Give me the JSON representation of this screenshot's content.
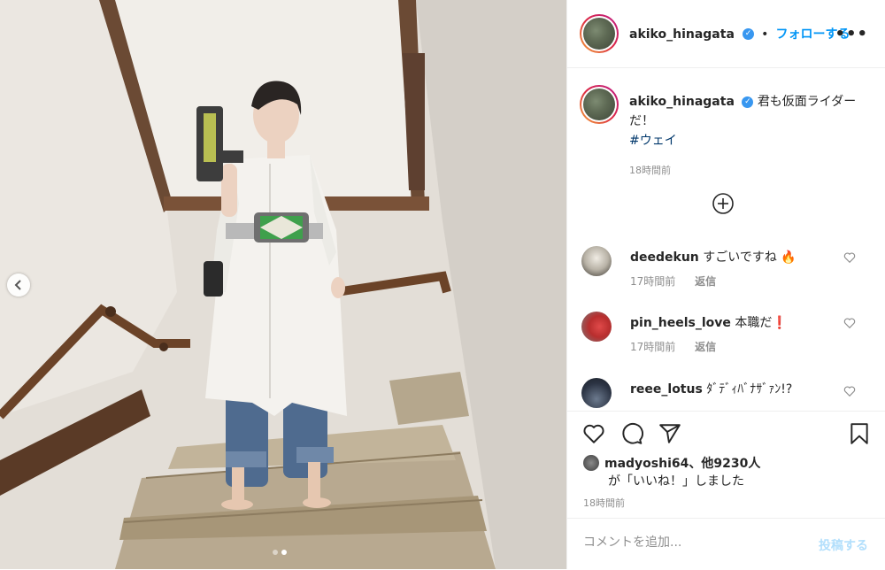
{
  "post": {
    "username": "akiko_hinagata",
    "follow_label": "フォローする",
    "more_label": "•••",
    "separator": "•"
  },
  "caption": {
    "username": "akiko_hinagata",
    "text": "君も仮面ライダーだ！",
    "hashtag": "#ウェイ",
    "time": "18時間前"
  },
  "comments": [
    {
      "username": "deedekun",
      "text": "すごいですね 🔥",
      "time": "17時間前",
      "reply_label": "返信"
    },
    {
      "username": "pin_heels_love",
      "text": "本職だ❗",
      "time": "17時間前",
      "reply_label": "返信"
    },
    {
      "username": "reee_lotus",
      "text": "ﾀﾞﾃﾞｨﾊﾞﾅｻﾞｧﾝ!?"
    }
  ],
  "likes": {
    "user": "madyoshi64",
    "count_text": "他9230人",
    "suffix": "が「いいね！」しました",
    "comma": "、"
  },
  "post_time": "18時間前",
  "comment_input": {
    "placeholder": "コメントを追加...",
    "post_label": "投稿する"
  },
  "carousel": {
    "total": 2,
    "current": 2
  },
  "icons": {
    "like": "heart-icon",
    "comment": "comment-icon",
    "share": "paper-plane-icon",
    "save": "bookmark-icon",
    "add": "plus-circle-icon",
    "prev": "chevron-left-icon"
  },
  "colors": {
    "accent": "#0095f6",
    "verified": "#3897f0",
    "hashtag": "#00376b",
    "muted": "#8e8e8e"
  }
}
